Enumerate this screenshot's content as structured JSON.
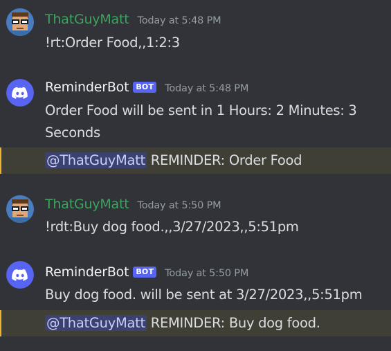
{
  "messages": [
    {
      "username": "ThatGuyMatt",
      "timestamp": "Today at 5:48 PM",
      "content": "!rt:Order Food,,1:2:3"
    },
    {
      "username": "ReminderBot",
      "bot_tag": "BOT",
      "timestamp": "Today at 5:48 PM",
      "content": "Order Food will be sent in 1 Hours: 2 Minutes: 3 Seconds",
      "reminder": {
        "mention": "@ThatGuyMatt",
        "text": " REMINDER: Order Food"
      }
    },
    {
      "username": "ThatGuyMatt",
      "timestamp": "Today at 5:50 PM",
      "content": "!rdt:Buy dog food.,,3/27/2023,,5:51pm"
    },
    {
      "username": "ReminderBot",
      "bot_tag": "BOT",
      "timestamp": "Today at 5:50 PM",
      "content": "Buy dog food. will be sent at 3/27/2023,,5:51pm",
      "reminder": {
        "mention": "@ThatGuyMatt",
        "text": " REMINDER: Buy dog food."
      }
    }
  ],
  "colors": {
    "background": "#313338",
    "user_name": "#3ba55d",
    "bot_tag": "#5865f2",
    "blurple": "#5865f2",
    "mention_highlight": "#403f36",
    "mention_pill": "#3c4270"
  },
  "icons": {
    "user_avatar": "pixel-face-glasses-icon",
    "bot_avatar": "discord-logo-icon"
  }
}
